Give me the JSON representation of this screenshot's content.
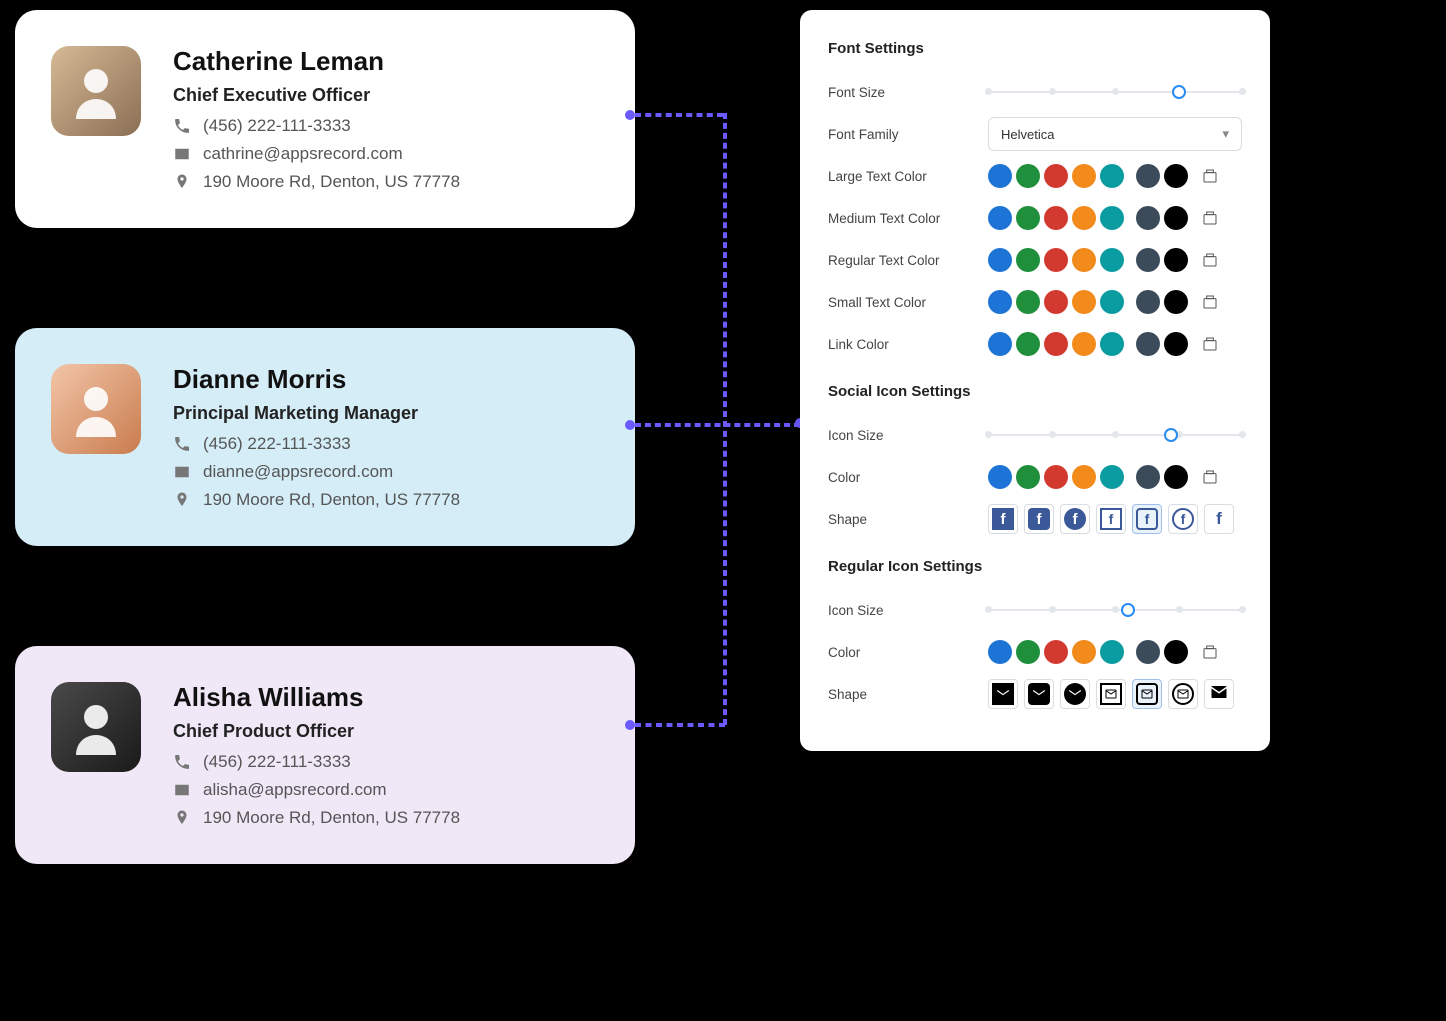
{
  "cards": [
    {
      "name": "Catherine Leman",
      "title": "Chief Executive Officer",
      "phone": "(456) 222-111-3333",
      "email": "cathrine@appsrecord.com",
      "address": "190 Moore Rd, Denton, US 77778"
    },
    {
      "name": "Dianne Morris",
      "title": "Principal Marketing Manager",
      "phone": "(456) 222-111-3333",
      "email": "dianne@appsrecord.com",
      "address": "190 Moore Rd, Denton, US 77778"
    },
    {
      "name": "Alisha Williams",
      "title": "Chief Product Officer",
      "phone": "(456) 222-111-3333",
      "email": "alisha@appsrecord.com",
      "address": "190 Moore Rd, Denton, US 77778"
    }
  ],
  "panel": {
    "font_settings_title": "Font Settings",
    "social_settings_title": "Social Icon Settings",
    "regular_settings_title": "Regular Icon Settings",
    "labels": {
      "font_size": "Font Size",
      "font_family": "Font Family",
      "large_text_color": "Large Text Color",
      "medium_text_color": "Medium Text Color",
      "regular_text_color": "Regular Text Color",
      "small_text_color": "Small Text Color",
      "link_color": "Link Color",
      "icon_size": "Icon Size",
      "color": "Color",
      "shape": "Shape"
    },
    "font_family_value": "Helvetica",
    "font_size_pos": 0.75,
    "social_icon_size_pos": 0.72,
    "regular_icon_size_pos": 0.55,
    "swatch_colors": [
      "#1e73d6",
      "#1f8f3b",
      "#d33a2f",
      "#f28a1c",
      "#0a9ca0",
      "#3c4b5a",
      "#000000"
    ],
    "social_shape_selected": 4,
    "regular_shape_selected": 4
  }
}
